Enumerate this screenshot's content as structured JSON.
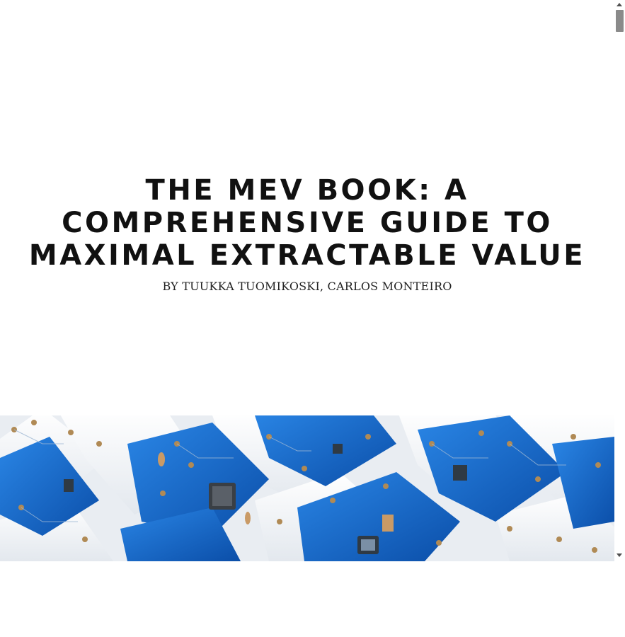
{
  "article": {
    "title": "THE MEV BOOK: A COMPREHENSIVE GUIDE TO MAXIMAL EXTRACTABLE VALUE",
    "byline": "BY TUUKKA TUOMIKOSKI, CARLOS MONTEIRO"
  },
  "hero_image": {
    "subject": "circuit-boards-image"
  },
  "colors": {
    "board_blue": "#1b6fd1",
    "board_deep_blue": "#0c4fa8",
    "acrylic_white": "#f4f6f8",
    "pad_gold": "#b08a55"
  }
}
